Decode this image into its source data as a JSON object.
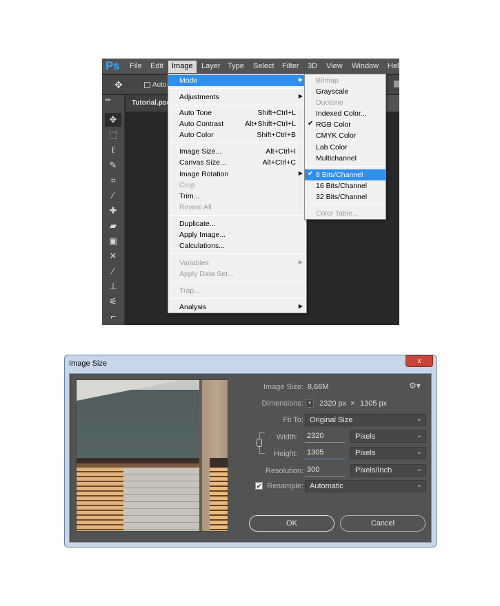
{
  "ps": {
    "logo": "Ps",
    "menu": [
      "File",
      "Edit",
      "Image",
      "Layer",
      "Type",
      "Select",
      "Filter",
      "3D",
      "View",
      "Window",
      "Hel"
    ],
    "options_label": "Auto-S",
    "doc_tab": "Tutorial.psd",
    "toolbar_collapse": "▸▸",
    "image_menu": [
      {
        "label": "Mode"
      },
      {
        "label": "Adjustments"
      },
      {
        "label": "Auto Tone",
        "shortcut": "Shift+Ctrl+L"
      },
      {
        "label": "Auto Contrast",
        "shortcut": "Alt+Shift+Ctrl+L"
      },
      {
        "label": "Auto Color",
        "shortcut": "Shift+Ctrl+B"
      },
      {
        "label": "Image Size...",
        "shortcut": "Alt+Ctrl+I"
      },
      {
        "label": "Canvas Size...",
        "shortcut": "Alt+Ctrl+C"
      },
      {
        "label": "Image Rotation"
      },
      {
        "label": "Crop"
      },
      {
        "label": "Trim..."
      },
      {
        "label": "Reveal All"
      },
      {
        "label": "Duplicate..."
      },
      {
        "label": "Apply Image..."
      },
      {
        "label": "Calculations..."
      },
      {
        "label": "Variables"
      },
      {
        "label": "Apply Data Set..."
      },
      {
        "label": "Trap..."
      },
      {
        "label": "Analysis"
      }
    ],
    "mode_menu": [
      {
        "label": "Bitmap"
      },
      {
        "label": "Grayscale"
      },
      {
        "label": "Duotone"
      },
      {
        "label": "Indexed Color..."
      },
      {
        "label": "RGB Color",
        "checked": true
      },
      {
        "label": "CMYK Color"
      },
      {
        "label": "Lab Color"
      },
      {
        "label": "Multichannel"
      },
      {
        "label": "8 Bits/Channel",
        "checked": true
      },
      {
        "label": "16 Bits/Channel"
      },
      {
        "label": "32 Bits/Channel"
      },
      {
        "label": "Color Table..."
      }
    ]
  },
  "dialog": {
    "title": "Image Size",
    "close": "x",
    "image_size_label": "Image Size:",
    "image_size_value": "8,66M",
    "dimensions_label": "Dimensions:",
    "dimensions_width": "2320 px",
    "dimensions_times": "×",
    "dimensions_height": "1305 px",
    "fit_to_label": "Fit To:",
    "fit_to_value": "Original Size",
    "width_label": "Width:",
    "width_value": "2320",
    "width_unit": "Pixels",
    "height_label": "Height:",
    "height_value": "1305",
    "height_unit": "Pixels",
    "resolution_label": "Resolution:",
    "resolution_value": "300",
    "resolution_unit": "Pixels/Inch",
    "resample_label": "Resample:",
    "resample_checked": true,
    "resample_value": "Automatic",
    "ok_label": "OK",
    "cancel_label": "Cancel"
  },
  "colors": {
    "ps_accent": "#31a8ff",
    "menu_highlight": "#2f8fee",
    "dialog_frame": "#c7d6e8",
    "dialog_panel": "#535353"
  }
}
